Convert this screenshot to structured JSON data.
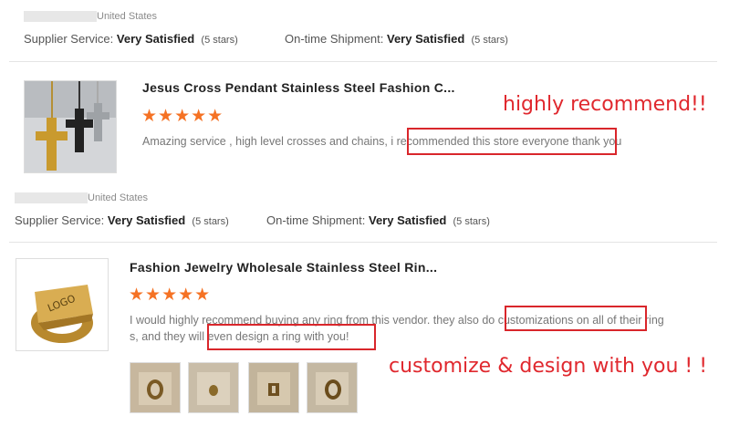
{
  "review1": {
    "location": "United States",
    "ratings": {
      "supplier_label": "Supplier Service:",
      "supplier_value": "Very Satisfied",
      "supplier_stars": "(5 stars)",
      "shipment_label": "On-time Shipment:",
      "shipment_value": "Very Satisfied",
      "shipment_stars": "(5 stars)"
    },
    "product_title": "Jesus Cross Pendant Stainless Steel Fashion C...",
    "stars": "★★★★★",
    "review_text_a": "Amazing service , high level crosses and chains",
    "review_text_b": ", i recommended this store everyone",
    "review_text_c": " thank you",
    "annotation": "highly  recommend!!"
  },
  "review2": {
    "location": "United States",
    "ratings": {
      "supplier_label": "Supplier Service:",
      "supplier_value": "Very Satisfied",
      "supplier_stars": "(5 stars)",
      "shipment_label": "On-time Shipment:",
      "shipment_value": "Very Satisfied",
      "shipment_stars": "(5 stars)"
    },
    "product_title": "Fashion Jewelry Wholesale Stainless Steel Rin...",
    "ring_logo_text": "LOGO",
    "stars": "★★★★★",
    "review_line1_a": "I would highly recommend buying any ring from this vendor. they also ",
    "review_line1_b": "do customizations on all",
    "review_line1_c": " of their ring",
    "review_line2_a": "s, and they will ",
    "review_line2_b": "even design a ring with you!",
    "annotation": "customize & design with you ! !"
  },
  "colors": {
    "star_orange": "#f57224",
    "annotation_red": "#e0282e"
  }
}
